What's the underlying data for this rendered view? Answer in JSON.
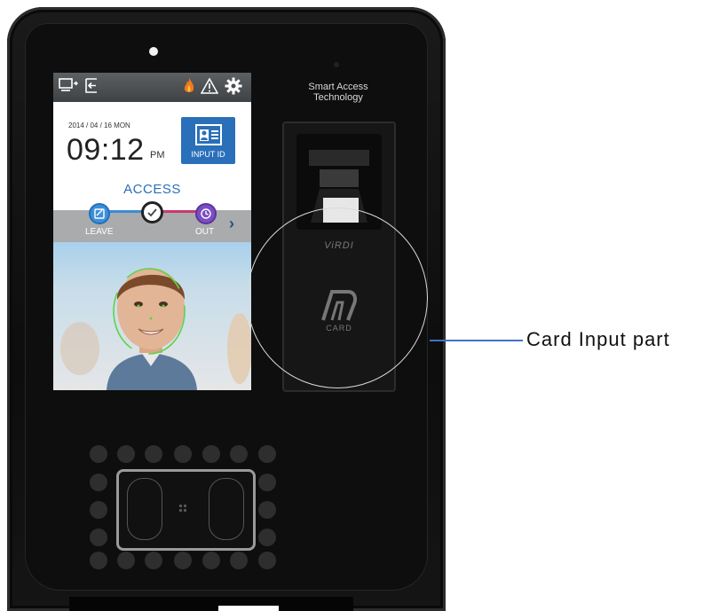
{
  "screen": {
    "topbar": {
      "left_icons": [
        "monitor-arrow-icon",
        "exit-icon"
      ],
      "right_icons": [
        "flame-icon",
        "warning-icon",
        "gear-icon"
      ]
    },
    "date": "2014 / 04 / 16 MON",
    "time": "09:12",
    "ampm": "PM",
    "input_id_label": "INPUT ID",
    "access_label": "ACCESS",
    "modes": {
      "left_label": "LEAVE",
      "right_label": "OUT"
    }
  },
  "device": {
    "brand_text": "Smart Access Technology",
    "brand_line1": "Smart Access",
    "brand_line2": "Technology",
    "virdi_text": "ViRDI",
    "card_text": "CARD"
  },
  "callout": {
    "text": "Card Input part"
  },
  "colors": {
    "accent": "#2a6fb9",
    "callout_line": "#4472c4",
    "face_outline": "#5fd24a"
  }
}
